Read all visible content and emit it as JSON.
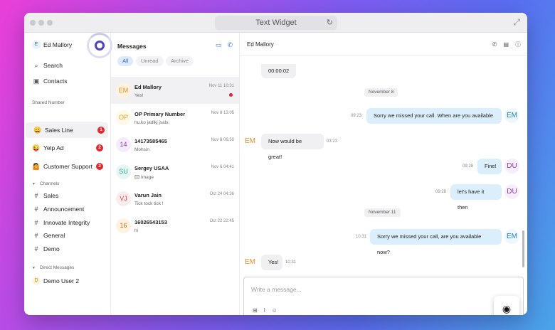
{
  "window": {
    "title": "Text Widget"
  },
  "sidebar": {
    "user": {
      "initial": "E",
      "name": "Ed Mallory"
    },
    "nav": [
      {
        "label": "Search",
        "icon": "search-icon",
        "glyph": "⌕"
      },
      {
        "label": "Contacts",
        "icon": "contacts-icon",
        "glyph": "▣"
      }
    ],
    "shared_heading": "Shared Number",
    "shared": [
      {
        "label": "Sales Line",
        "emoji": "😀",
        "badge": "1"
      },
      {
        "label": "Yelp Ad",
        "emoji": "😜",
        "badge": "2"
      },
      {
        "label": "Customer Support",
        "emoji": "🤷",
        "badge": "2"
      }
    ],
    "channels_heading": "Channels",
    "channels": [
      "Sales",
      "Announcement",
      "Innovate Integrity",
      "General",
      "Demo"
    ],
    "dm_heading": "Direct Messages",
    "dms": [
      {
        "initial": "D",
        "name": "Demo User 2"
      }
    ]
  },
  "messages": {
    "title": "Messages",
    "tabs": [
      "All",
      "Unread",
      "Archive"
    ],
    "conversations": [
      {
        "initials": "EM",
        "name": "Ed Mallory",
        "preview": "Yes!",
        "time": "Nov 11 10:31",
        "unread": true
      },
      {
        "initials": "OP",
        "name": "OP Primary Number",
        "preview": "hu.ko jadlkj jsals.",
        "time": "Nov 8 13:05",
        "unread": false
      },
      {
        "initials": "14",
        "name": "14173585465",
        "preview": "Mohsin",
        "time": "Nov 8 06:50",
        "unread": false
      },
      {
        "initials": "SU",
        "name": "Sergey USAA",
        "preview": "Image",
        "time": "Nov 6 04:41",
        "unread": false
      },
      {
        "initials": "VJ",
        "name": "Varun Jain",
        "preview": "Tick tock tick !",
        "time": "Oct 24 04:36",
        "unread": false
      },
      {
        "initials": "16",
        "name": "16026543153",
        "preview": "hi",
        "time": "Oct 22 22:45",
        "unread": false
      }
    ]
  },
  "chat": {
    "contact": "Ed Mallory",
    "call_timer": "00:00:02",
    "date1": "November 8",
    "m1": {
      "text": "Sorry we missed your call.  When are you available",
      "time": "09:23",
      "avatar": "EM"
    },
    "m2": {
      "text": "Now would be great!",
      "time": "03:23",
      "avatar": "EM"
    },
    "m3": {
      "text": "Fine!",
      "time": "09:28",
      "avatar": "DU"
    },
    "m4": {
      "text": "let's have it then",
      "time": "09:28",
      "avatar": "DU"
    },
    "date2": "November 11",
    "m5": {
      "text": "Sorry we missed your call, are you available now?",
      "time": "10:31",
      "avatar": "EM"
    },
    "m6": {
      "text": "Yes!",
      "time": "10:31",
      "avatar": "EM"
    },
    "composer_placeholder": "Write a message..."
  },
  "colors": {
    "accent": "#3b7bd9",
    "badge": "#e5262b",
    "outgoing_bubble": "#dbeefc",
    "incoming_bubble": "#f0f0f2"
  }
}
